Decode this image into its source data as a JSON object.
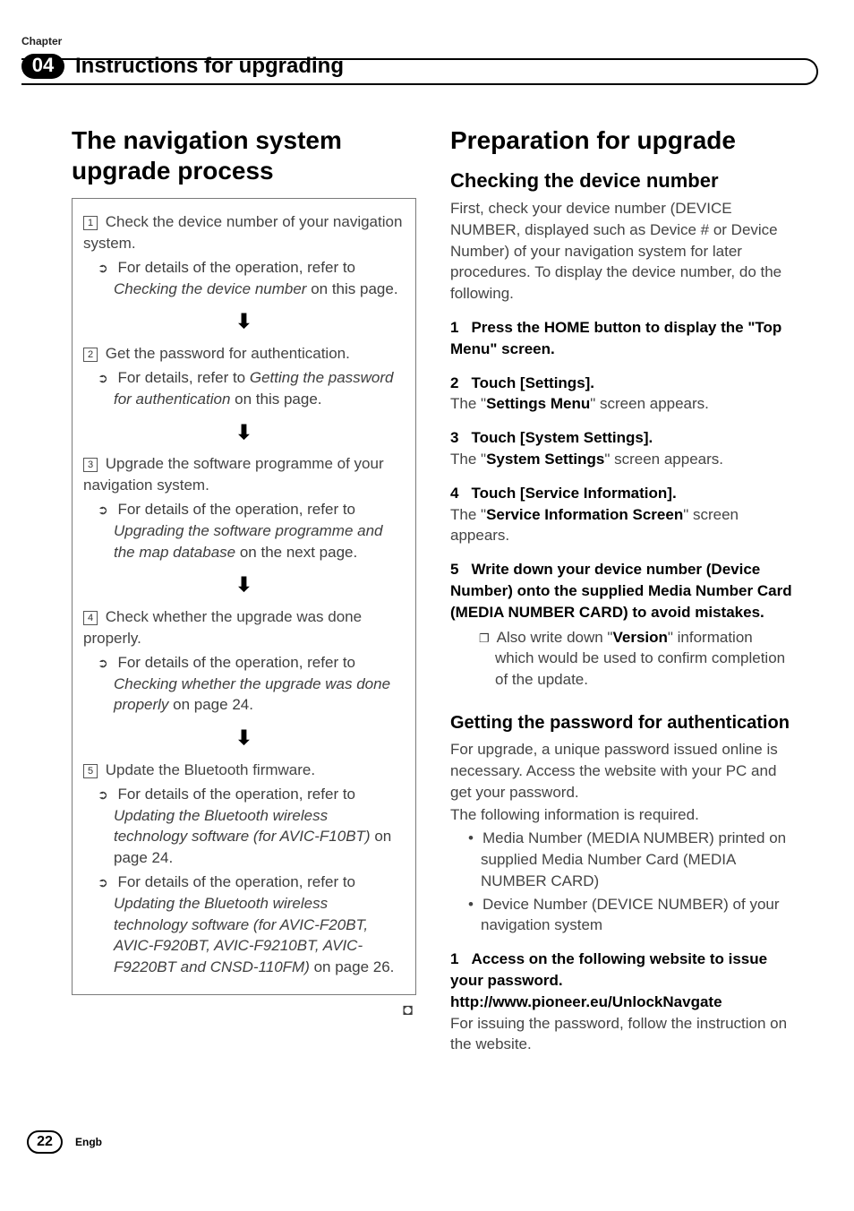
{
  "header": {
    "chapter_label": "Chapter",
    "chapter_number": "04",
    "chapter_title": "Instructions for upgrading"
  },
  "left": {
    "title": "The navigation system upgrade process",
    "steps": [
      {
        "text": "Check the device number of your navigation system.",
        "sub": [
          "For details of the operation, refer to "
        ],
        "sub_italic": [
          "Checking the device number"
        ],
        "sub_after": [
          " on this page."
        ]
      },
      {
        "text": "Get the password for authentication.",
        "sub": [
          "For details, refer to "
        ],
        "sub_italic": [
          "Getting the password for authentication"
        ],
        "sub_after": [
          " on this page."
        ]
      },
      {
        "text": "Upgrade the software programme of your navigation system.",
        "sub": [
          "For details of the operation, refer to "
        ],
        "sub_italic": [
          "Upgrading the software programme and the map database"
        ],
        "sub_after": [
          " on the next page."
        ]
      },
      {
        "text": "Check whether the upgrade was done properly.",
        "sub": [
          "For details of the operation, refer to "
        ],
        "sub_italic": [
          "Checking whether the upgrade was done properly"
        ],
        "sub_after": [
          " on page 24."
        ]
      },
      {
        "text": "Update the Bluetooth firmware.",
        "sub": [
          "For details of the operation, refer to ",
          "For details of the operation, refer to "
        ],
        "sub_italic": [
          "Updating the Bluetooth wireless technology software (for AVIC-F10BT)",
          "Updating the Bluetooth wireless technology software (for AVIC-F20BT, AVIC-F920BT, AVIC-F9210BT, AVIC-F9220BT and CNSD-110FM)"
        ],
        "sub_after": [
          " on page 24.",
          " on page 26."
        ]
      }
    ]
  },
  "right": {
    "title1": "Preparation for upgrade",
    "h2_1": "Checking the device number",
    "p1": "First, check your device number (DEVICE NUMBER, displayed such as Device # or Device Number) of your navigation system for later procedures. To display the device number, do the following.",
    "s1_n": "1",
    "s1": "Press the HOME button to display the \"Top Menu\" screen.",
    "s2_n": "2",
    "s2": "Touch [Settings].",
    "s2_res_a": "The \"",
    "s2_res_b": "Settings Menu",
    "s2_res_c": "\" screen appears.",
    "s3_n": "3",
    "s3": "Touch [System Settings].",
    "s3_res_a": "The \"",
    "s3_res_b": "System Settings",
    "s3_res_c": "\" screen appears.",
    "s4_n": "4",
    "s4": "Touch [Service Information].",
    "s4_res_a": "The \"",
    "s4_res_b": "Service Information Screen",
    "s4_res_c": "\" screen appears.",
    "s5_n": "5",
    "s5": "Write down your device number (Device Number) onto the supplied Media Number Card (MEDIA NUMBER CARD) to avoid mistakes.",
    "s5_sub_a": "Also write down \"",
    "s5_sub_b": "Version",
    "s5_sub_c": "\" information which would be used to confirm completion of the update.",
    "h3": "Getting the password for authentication",
    "p2": "For upgrade, a unique password issued online is necessary. Access the website with your PC and get your password.",
    "p3": "The following information is required.",
    "b1": "Media Number (MEDIA NUMBER) printed on supplied Media Number Card (MEDIA NUMBER CARD)",
    "b2": "Device Number (DEVICE NUMBER) of your navigation system",
    "s6_n": "1",
    "s6": "Access on the following website to issue your password.",
    "url": "http://www.pioneer.eu/UnlockNavgate",
    "p4": "For issuing the password, follow the instruction on the website."
  },
  "footer": {
    "page": "22",
    "lang": "Engb"
  }
}
